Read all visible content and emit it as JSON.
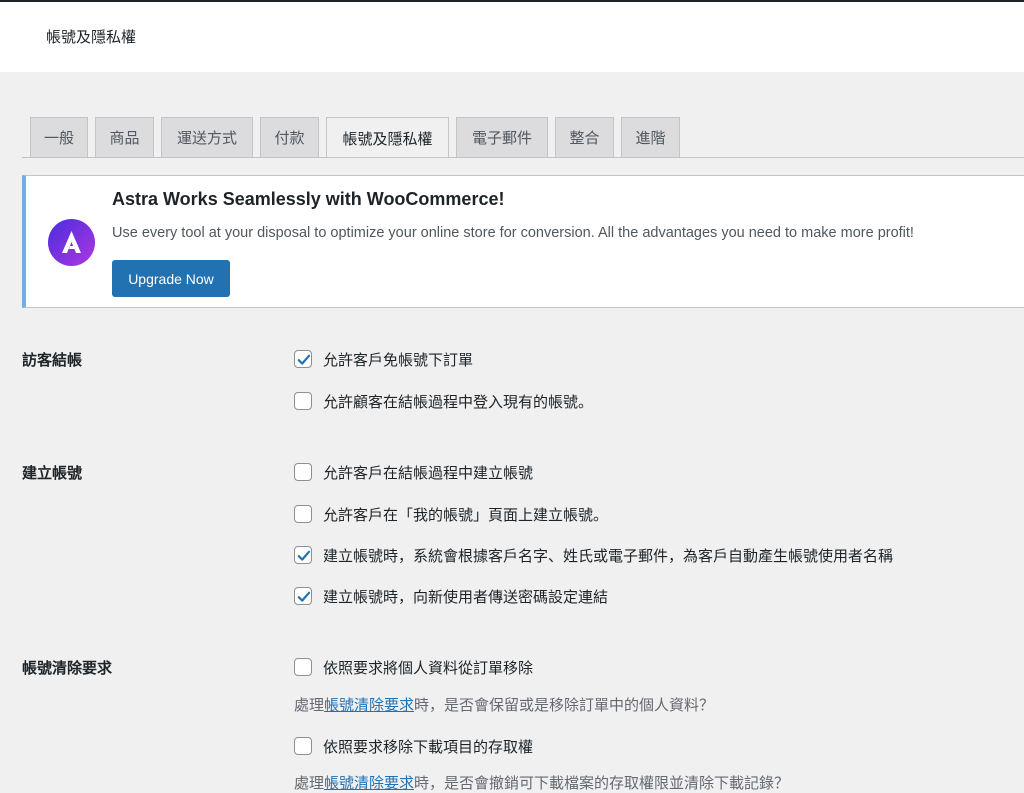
{
  "header": {
    "title": "帳號及隱私權"
  },
  "tabs": [
    {
      "label": "一般"
    },
    {
      "label": "商品"
    },
    {
      "label": "運送方式"
    },
    {
      "label": "付款"
    },
    {
      "label": "帳號及隱私權"
    },
    {
      "label": "電子郵件"
    },
    {
      "label": "整合"
    },
    {
      "label": "進階"
    }
  ],
  "active_tab": "帳號及隱私權",
  "notice": {
    "title": "Astra Works Seamlessly with WooCommerce!",
    "description": "Use every tool at your disposal to optimize your online store for conversion. All the advantages you need to make more profit!",
    "button": "Upgrade Now",
    "logo_icon": "astra-logo-icon"
  },
  "sections": {
    "guest_checkout": {
      "label": "訪客結帳",
      "options": [
        {
          "label": "允許客戶免帳號下訂單",
          "checked": true
        },
        {
          "label": "允許顧客在結帳過程中登入現有的帳號。",
          "checked": false
        }
      ]
    },
    "account_creation": {
      "label": "建立帳號",
      "options": [
        {
          "label": "允許客戶在結帳過程中建立帳號",
          "checked": false
        },
        {
          "label": "允許客戶在「我的帳號」頁面上建立帳號。",
          "checked": false
        },
        {
          "label": "建立帳號時，系統會根據客戶名字、姓氏或電子郵件，為客戶自動產生帳號使用者名稱",
          "checked": true
        },
        {
          "label": "建立帳號時，向新使用者傳送密碼設定連結",
          "checked": true
        }
      ]
    },
    "erasure": {
      "label": "帳號清除要求",
      "options": [
        {
          "label": "依照要求將個人資料從訂單移除",
          "checked": false,
          "desc_prefix": "處理",
          "desc_link": "帳號清除要求",
          "desc_suffix": "時，是否會保留或是移除訂單中的個人資料？"
        },
        {
          "label": "依照要求移除下載項目的存取權",
          "checked": false,
          "desc_prefix": "處理",
          "desc_link": "帳號清除要求",
          "desc_suffix": "時，是否會撤銷可下載檔案的存取權限並清除下載記錄？"
        }
      ]
    }
  },
  "colors": {
    "accent": "#2271b1",
    "notice_border": "#72aee6",
    "tab_bg": "#dcdcde",
    "page_bg": "#f0f0f1"
  }
}
